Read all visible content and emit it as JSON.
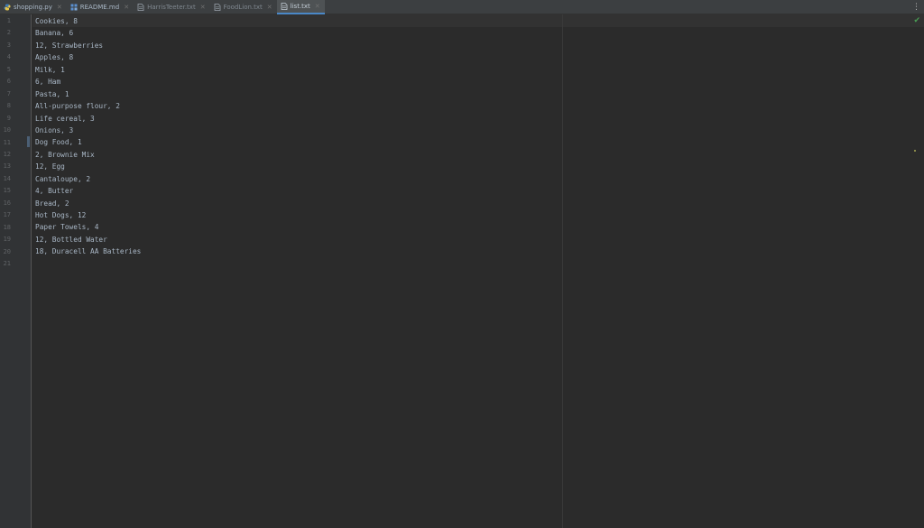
{
  "tabs": [
    {
      "label": "shopping.py",
      "icon": "python-file-icon",
      "active": false,
      "dim": false
    },
    {
      "label": "README.md",
      "icon": "markdown-file-icon",
      "active": false,
      "dim": false
    },
    {
      "label": "HarrisTeeter.txt",
      "icon": "text-file-icon",
      "active": false,
      "dim": true
    },
    {
      "label": "FoodLion.txt",
      "icon": "text-file-icon",
      "active": false,
      "dim": true
    },
    {
      "label": "list.txt",
      "icon": "text-file-icon",
      "active": true,
      "dim": false
    }
  ],
  "editor": {
    "lines": [
      "Cookies, 8",
      "Banana, 6",
      "12, Strawberries",
      "Apples, 8",
      "Milk, 1",
      "6, Ham",
      "Pasta, 1",
      "All-purpose flour, 2",
      "Life cereal, 3",
      "Onions, 3",
      "Dog Food, 1",
      "2, Brownie Mix",
      "12, Egg",
      "Cantaloupe, 2",
      "4, Butter",
      "Bread, 2",
      "Hot Dogs, 12",
      "Paper Towels, 4",
      "12, Bottled Water",
      "18, Duracell AA Batteries",
      ""
    ],
    "line_numbers": [
      "1",
      "2",
      "3",
      "4",
      "5",
      "6",
      "7",
      "8",
      "9",
      "10",
      "11",
      "12",
      "13",
      "14",
      "15",
      "16",
      "17",
      "18",
      "19",
      "20",
      "21"
    ]
  },
  "colors": {
    "editor_bg": "#2b2b2b",
    "text": "#a9b7c6",
    "gutter_bg": "#313335",
    "active_tab_underline": "#4a88c7",
    "ok_check": "#499c54"
  }
}
